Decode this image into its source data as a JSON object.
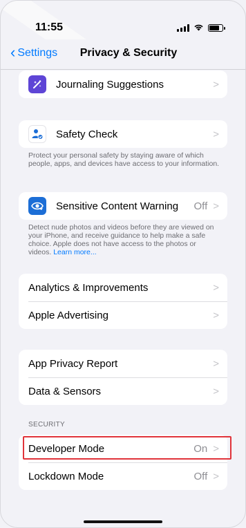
{
  "status_bar": {
    "time": "11:55"
  },
  "nav": {
    "back_label": "Settings",
    "title": "Privacy & Security"
  },
  "groups": {
    "journaling": {
      "label": "Journaling Suggestions"
    },
    "safety": {
      "label": "Safety Check",
      "footnote": "Protect your personal safety by staying aware of which people, apps, and devices have access to your information."
    },
    "sensitive": {
      "label": "Sensitive Content Warning",
      "value": "Off",
      "footnote": "Detect nude photos and videos before they are viewed on your iPhone, and receive guidance to help make a safe choice. Apple does not have access to the photos or videos.",
      "footnote_link": "Learn more..."
    },
    "analytics": {
      "items": [
        {
          "label": "Analytics & Improvements"
        },
        {
          "label": "Apple Advertising"
        }
      ]
    },
    "privacy_report": {
      "items": [
        {
          "label": "App Privacy Report"
        },
        {
          "label": "Data & Sensors"
        }
      ]
    },
    "security": {
      "header": "SECURITY",
      "items": [
        {
          "label": "Developer Mode",
          "value": "On"
        },
        {
          "label": "Lockdown Mode",
          "value": "Off"
        }
      ]
    }
  },
  "colors": {
    "accent": "#007aff",
    "highlight_border": "#e0333a"
  },
  "icons": {
    "back": "chevron-left-icon",
    "journal": "journaling-suggestions-icon",
    "safety": "safety-check-icon",
    "sensitive": "sensitive-content-warning-icon",
    "disclosure": "chevron-right-icon"
  }
}
